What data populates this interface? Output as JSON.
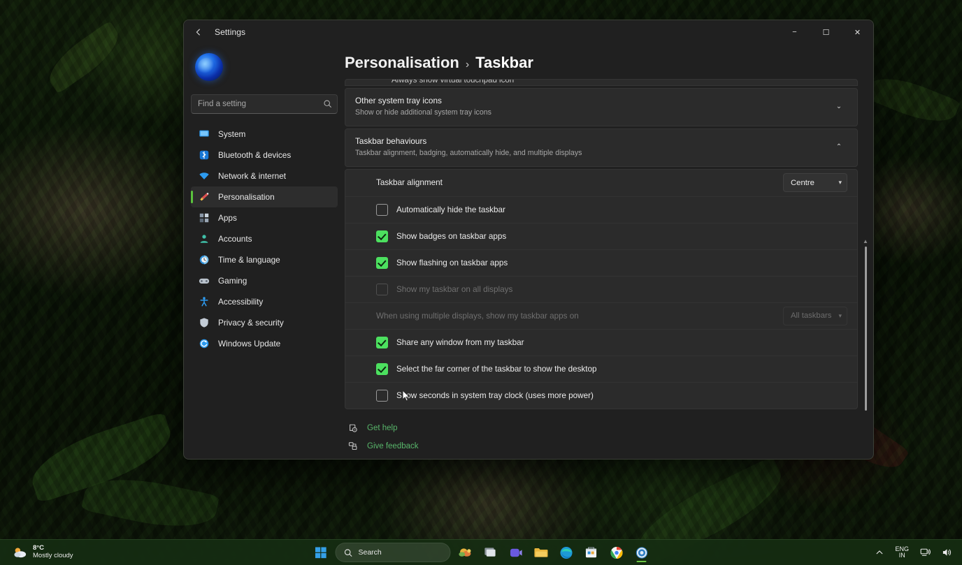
{
  "window": {
    "title": "Settings",
    "back_icon": "arrow-left-icon",
    "controls": {
      "minimize": "−",
      "maximize": "☐",
      "close": "✕"
    }
  },
  "sidebar": {
    "search_placeholder": "Find a setting",
    "search_icon": "search-icon",
    "items": [
      {
        "label": "System",
        "icon": "monitor-icon"
      },
      {
        "label": "Bluetooth & devices",
        "icon": "bluetooth-icon"
      },
      {
        "label": "Network & internet",
        "icon": "wifi-icon"
      },
      {
        "label": "Personalisation",
        "icon": "paintbrush-icon",
        "active": true
      },
      {
        "label": "Apps",
        "icon": "apps-grid-icon"
      },
      {
        "label": "Accounts",
        "icon": "person-icon"
      },
      {
        "label": "Time & language",
        "icon": "clock-globe-icon"
      },
      {
        "label": "Gaming",
        "icon": "gamepad-icon"
      },
      {
        "label": "Accessibility",
        "icon": "accessibility-person-icon"
      },
      {
        "label": "Privacy & security",
        "icon": "shield-icon"
      },
      {
        "label": "Windows Update",
        "icon": "update-refresh-icon"
      }
    ]
  },
  "breadcrumb": {
    "parent": "Personalisation",
    "separator": "›",
    "current": "Taskbar"
  },
  "main": {
    "clipped_card_label": "Always show virtual touchpad icon",
    "cards": [
      {
        "title": "Other system tray icons",
        "subtitle": "Show or hide additional system tray icons",
        "expanded": false,
        "chevron": "⌄"
      },
      {
        "title": "Taskbar behaviours",
        "subtitle": "Taskbar alignment, badging, automatically hide, and multiple displays",
        "expanded": true,
        "chevron": "⌃"
      }
    ],
    "rows": [
      {
        "type": "dropdown",
        "label": "Taskbar alignment",
        "value": "Centre",
        "disabled": false
      },
      {
        "type": "checkbox",
        "label": "Automatically hide the taskbar",
        "checked": false,
        "disabled": false
      },
      {
        "type": "checkbox",
        "label": "Show badges on taskbar apps",
        "checked": true,
        "disabled": false
      },
      {
        "type": "checkbox",
        "label": "Show flashing on taskbar apps",
        "checked": true,
        "disabled": false
      },
      {
        "type": "checkbox",
        "label": "Show my taskbar on all displays",
        "checked": false,
        "disabled": true
      },
      {
        "type": "dropdown",
        "label": "When using multiple displays, show my taskbar apps on",
        "value": "All taskbars",
        "disabled": true
      },
      {
        "type": "checkbox",
        "label": "Share any window from my taskbar",
        "checked": true,
        "disabled": false
      },
      {
        "type": "checkbox",
        "label": "Select the far corner of the taskbar to show the desktop",
        "checked": true,
        "disabled": false
      },
      {
        "type": "checkbox",
        "label": "Show seconds in system tray clock (uses more power)",
        "checked": false,
        "disabled": false
      }
    ],
    "footer_links": [
      {
        "label": "Get help",
        "icon": "help-question-icon"
      },
      {
        "label": "Give feedback",
        "icon": "feedback-icon"
      }
    ]
  },
  "taskbar": {
    "weather": {
      "temperature": "8°C",
      "condition": "Mostly cloudy",
      "icon": "partly-cloudy-icon"
    },
    "search": {
      "label": "Search",
      "icon": "search-icon"
    },
    "apps": [
      {
        "name": "start-button",
        "icon": "windows-logo-icon"
      },
      {
        "name": "widgets-button",
        "icon": "widgets-icon"
      },
      {
        "name": "task-view-button",
        "icon": "task-view-icon"
      },
      {
        "name": "teams-button",
        "icon": "teams-camera-icon"
      },
      {
        "name": "file-explorer-button",
        "icon": "folder-icon"
      },
      {
        "name": "edge-button",
        "icon": "edge-browser-icon"
      },
      {
        "name": "store-button",
        "icon": "microsoft-store-icon"
      },
      {
        "name": "chrome-button",
        "icon": "chrome-browser-icon"
      },
      {
        "name": "settings-button",
        "icon": "settings-gear-icon",
        "active": true
      }
    ],
    "tray": {
      "expand_icon": "chevron-up-icon",
      "language": {
        "line1": "ENG",
        "line2": "IN"
      },
      "network_icon": "network-icon",
      "volume_icon": "speaker-icon"
    }
  },
  "accent": {
    "green": "#4ce05f",
    "link_green": "#58b56a",
    "selection": "#5ac23d"
  }
}
